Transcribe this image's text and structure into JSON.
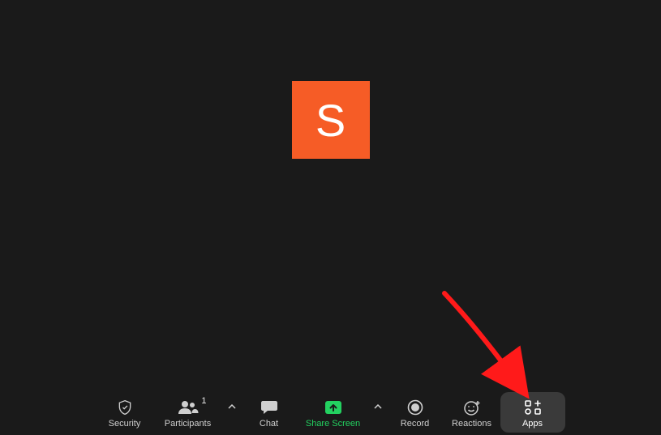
{
  "avatar": {
    "letter": "S",
    "bg": "#f65c26"
  },
  "toolbar": {
    "security": {
      "label": "Security"
    },
    "participants": {
      "label": "Participants",
      "count": "1"
    },
    "chat": {
      "label": "Chat"
    },
    "share": {
      "label": "Share Screen"
    },
    "record": {
      "label": "Record"
    },
    "reactions": {
      "label": "Reactions"
    },
    "apps": {
      "label": "Apps"
    }
  },
  "colors": {
    "accent": "#23d160",
    "highlight_bg": "#3a3a3a",
    "arrow": "#ff1a1a"
  }
}
